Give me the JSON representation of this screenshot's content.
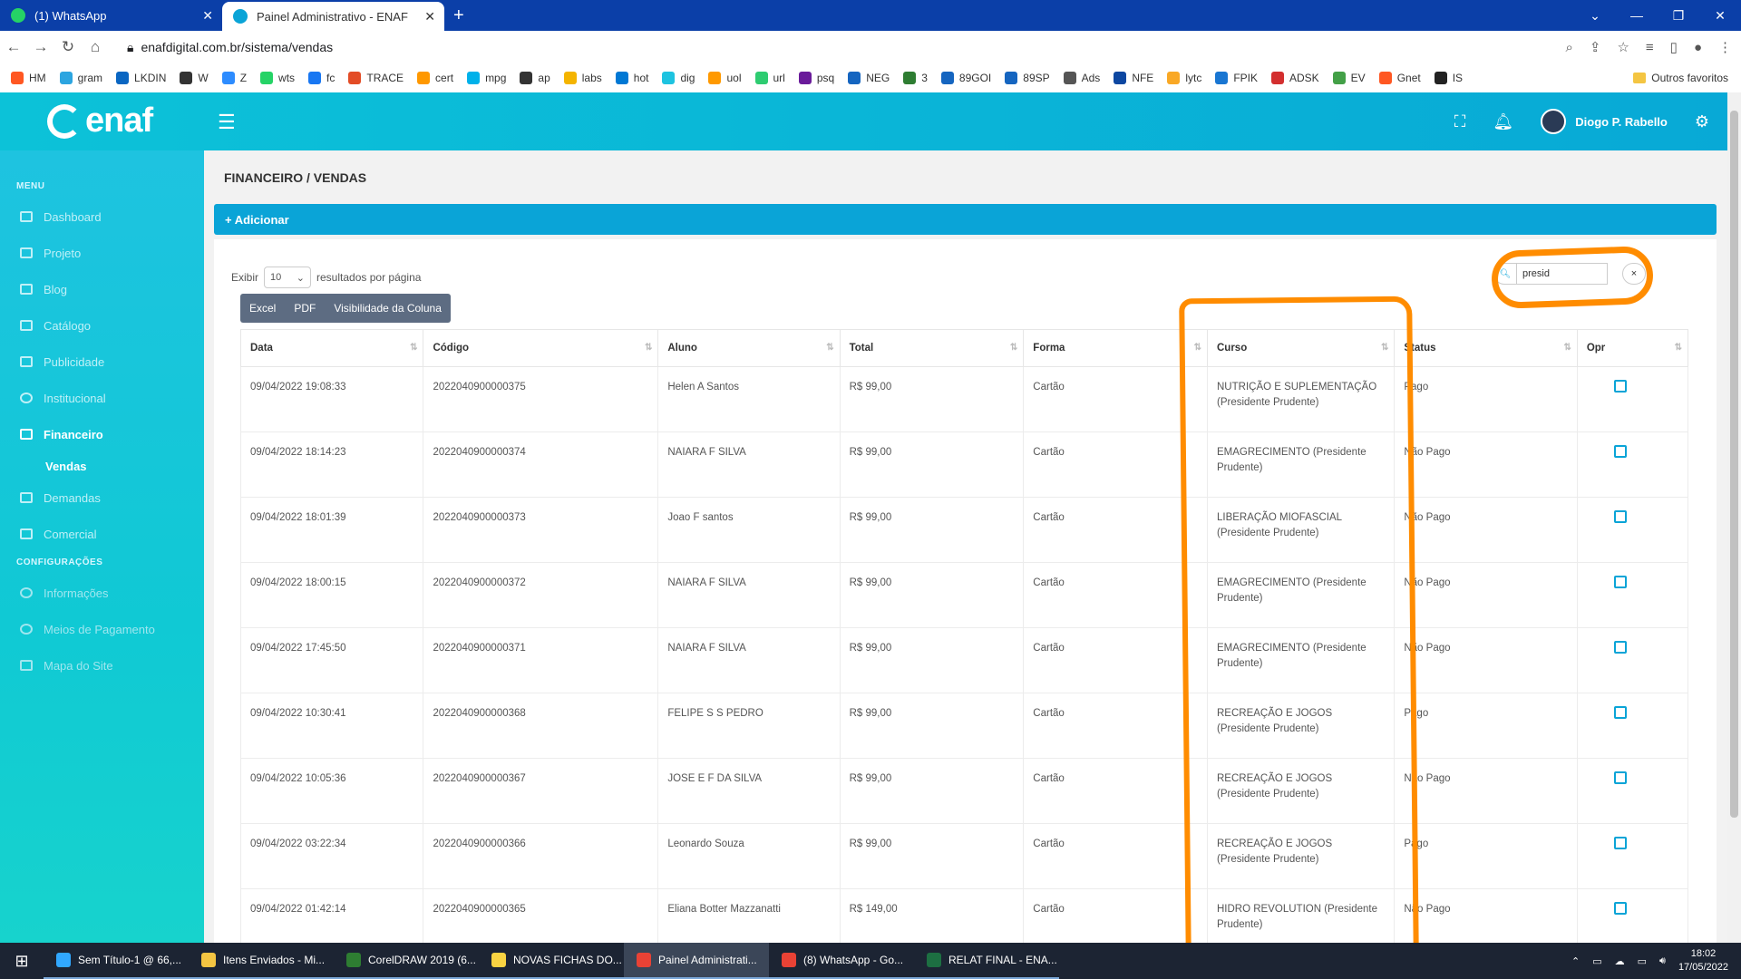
{
  "browser": {
    "tabs": [
      {
        "title": "(1) WhatsApp",
        "color": "#25d366"
      },
      {
        "title": "Painel Administrativo - ENAF",
        "color": "#0aa4d7"
      }
    ],
    "url": "enafdigital.com.br/sistema/vendas",
    "bookmarks": [
      {
        "label": "HM",
        "color": "#ff5722"
      },
      {
        "label": "gram",
        "color": "#2ca5e0"
      },
      {
        "label": "LKDIN",
        "color": "#0a66c2"
      },
      {
        "label": "W",
        "color": "#333333"
      },
      {
        "label": "Z",
        "color": "#2d8cff"
      },
      {
        "label": "wts",
        "color": "#25d366"
      },
      {
        "label": "fc",
        "color": "#1877f2"
      },
      {
        "label": "TRACE",
        "color": "#e34c26"
      },
      {
        "label": "cert",
        "color": "#ff9800"
      },
      {
        "label": "mpg",
        "color": "#00b1ea"
      },
      {
        "label": "ap",
        "color": "#333333"
      },
      {
        "label": "labs",
        "color": "#f4b400"
      },
      {
        "label": "hot",
        "color": "#0078d4"
      },
      {
        "label": "dig",
        "color": "#1ec3e0"
      },
      {
        "label": "uol",
        "color": "#ff9900"
      },
      {
        "label": "url",
        "color": "#2ecc71"
      },
      {
        "label": "psq",
        "color": "#6a1b9a"
      },
      {
        "label": "NEG",
        "color": "#1565c0"
      },
      {
        "label": "3",
        "color": "#2e7d32"
      },
      {
        "label": "89GOI",
        "color": "#1565c0"
      },
      {
        "label": "89SP",
        "color": "#1565c0"
      },
      {
        "label": "Ads",
        "color": "#555555"
      },
      {
        "label": "NFE",
        "color": "#0d47a1"
      },
      {
        "label": "lytc",
        "color": "#f9a825"
      },
      {
        "label": "FPIK",
        "color": "#1976d2"
      },
      {
        "label": "ADSK",
        "color": "#d32f2f"
      },
      {
        "label": "EV",
        "color": "#43a047"
      },
      {
        "label": "Gnet",
        "color": "#ff5722"
      },
      {
        "label": "IS",
        "color": "#222222"
      }
    ],
    "other_favorites": "Outros favoritos"
  },
  "header": {
    "logo": "enaf",
    "user": "Diogo P. Rabello"
  },
  "sidebar": {
    "section_menu": "MENU",
    "items": [
      {
        "label": "Dashboard",
        "state": "normal"
      },
      {
        "label": "Projeto",
        "state": "normal"
      },
      {
        "label": "Blog",
        "state": "normal"
      },
      {
        "label": "Catálogo",
        "state": "normal"
      },
      {
        "label": "Publicidade",
        "state": "normal"
      },
      {
        "label": "Institucional",
        "state": "normal"
      },
      {
        "label": "Financeiro",
        "state": "active"
      }
    ],
    "sub_item": "Vendas",
    "items2": [
      {
        "label": "Demandas"
      },
      {
        "label": "Comercial"
      }
    ],
    "section_config": "CONFIGURAÇÕES",
    "config_items": [
      {
        "label": "Informações"
      },
      {
        "label": "Meios de Pagamento"
      },
      {
        "label": "Mapa do Site"
      }
    ]
  },
  "main": {
    "title": "FINANCEIRO / VENDAS",
    "add_label": "+ Adicionar",
    "show_label": "Exibir",
    "page_size": "10",
    "per_page_label": "resultados por página",
    "buttons": [
      "Excel",
      "PDF",
      "Visibilidade da Coluna"
    ],
    "search_value": "presid",
    "clear": "×",
    "columns": [
      "Data",
      "Código",
      "Aluno",
      "Total",
      "Forma",
      "Curso",
      "Status",
      "Opr"
    ],
    "rows": [
      {
        "data": "09/04/2022 19:08:33",
        "codigo": "2022040900000375",
        "aluno": "Helen A Santos",
        "total": "R$ 99,00",
        "forma": "Cartão",
        "curso": "NUTRIÇÃO E SUPLEMENTAÇÃO (Presidente Prudente)",
        "status": "Pago"
      },
      {
        "data": "09/04/2022 18:14:23",
        "codigo": "2022040900000374",
        "aluno": "NAIARA F SILVA",
        "total": "R$ 99,00",
        "forma": "Cartão",
        "curso": "EMAGRECIMENTO (Presidente Prudente)",
        "status": "Não Pago"
      },
      {
        "data": "09/04/2022 18:01:39",
        "codigo": "2022040900000373",
        "aluno": "Joao F santos",
        "total": "R$ 99,00",
        "forma": "Cartão",
        "curso": "LIBERAÇÃO MIOFASCIAL (Presidente Prudente)",
        "status": "Não Pago"
      },
      {
        "data": "09/04/2022 18:00:15",
        "codigo": "2022040900000372",
        "aluno": "NAIARA F SILVA",
        "total": "R$ 99,00",
        "forma": "Cartão",
        "curso": "EMAGRECIMENTO (Presidente Prudente)",
        "status": "Não Pago"
      },
      {
        "data": "09/04/2022 17:45:50",
        "codigo": "2022040900000371",
        "aluno": "NAIARA F SILVA",
        "total": "R$ 99,00",
        "forma": "Cartão",
        "curso": "EMAGRECIMENTO (Presidente Prudente)",
        "status": "Não Pago"
      },
      {
        "data": "09/04/2022 10:30:41",
        "codigo": "2022040900000368",
        "aluno": "FELIPE S S PEDRO",
        "total": "R$ 99,00",
        "forma": "Cartão",
        "curso": "RECREAÇÃO E JOGOS (Presidente Prudente)",
        "status": "Pago"
      },
      {
        "data": "09/04/2022 10:05:36",
        "codigo": "2022040900000367",
        "aluno": "JOSE E F DA SILVA",
        "total": "R$ 99,00",
        "forma": "Cartão",
        "curso": "RECREAÇÃO E JOGOS (Presidente Prudente)",
        "status": "Não Pago"
      },
      {
        "data": "09/04/2022 03:22:34",
        "codigo": "2022040900000366",
        "aluno": "Leonardo Souza",
        "total": "R$ 99,00",
        "forma": "Cartão",
        "curso": "RECREAÇÃO E JOGOS (Presidente Prudente)",
        "status": "Pago"
      },
      {
        "data": "09/04/2022 01:42:14",
        "codigo": "2022040900000365",
        "aluno": "Eliana Botter Mazzanatti",
        "total": "R$ 149,00",
        "forma": "Cartão",
        "curso": "HIDRO REVOLUTION (Presidente Prudente)",
        "status": "Não Pago"
      }
    ]
  },
  "annotation_color": "#ff8c00",
  "taskbar": {
    "tasks": [
      {
        "label": "Sem Título-1 @ 66,...",
        "color": "#31a8ff"
      },
      {
        "label": "Itens Enviados - Mi...",
        "color": "#f4c542"
      },
      {
        "label": "CorelDRAW 2019 (6...",
        "color": "#2e7d32"
      },
      {
        "label": "NOVAS FICHAS DO...",
        "color": "#f9d342"
      },
      {
        "label": "Painel Administrati...",
        "color": "#e94235"
      },
      {
        "label": "(8) WhatsApp - Go...",
        "color": "#e94235"
      },
      {
        "label": "RELAT FINAL - ENA...",
        "color": "#1d6f42"
      }
    ],
    "time": "18:02",
    "date": "17/05/2022"
  }
}
